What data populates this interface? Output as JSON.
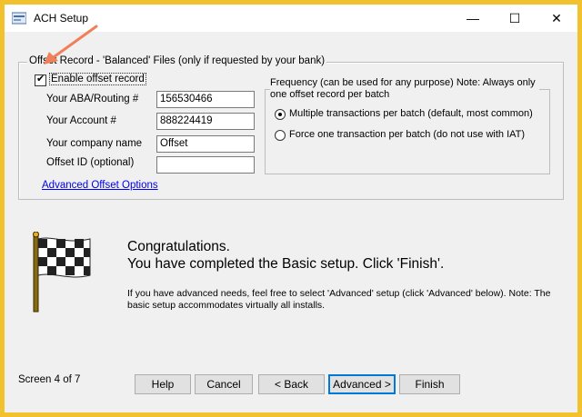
{
  "window": {
    "title": "ACH Setup",
    "controls": {
      "minimize": "—",
      "maximize": "☐",
      "close": "✕"
    }
  },
  "offset_group": {
    "legend": "Offset Record - 'Balanced' Files (only if requested by your bank)",
    "enable_label": "Enable offset record",
    "enable_checked": true,
    "fields": [
      {
        "label": "Your ABA/Routing #",
        "value": "156530466"
      },
      {
        "label": "Your Account #",
        "value": "888224419"
      },
      {
        "label": "Your company name",
        "value": "Offset"
      },
      {
        "label": "Offset ID (optional)",
        "value": ""
      }
    ],
    "frequency": {
      "legend": "Frequency (can be used for any purpose) Note: Always only one offset record per batch",
      "options": [
        {
          "label": "Multiple transactions per batch (default, most common)",
          "selected": true
        },
        {
          "label": "Force one transaction per batch (do not use with IAT)",
          "selected": false
        }
      ]
    },
    "advanced_link": "Advanced Offset Options"
  },
  "completion": {
    "line1": "Congratulations.",
    "line2": "You have completed the Basic setup. Click 'Finish'.",
    "note": "If you have advanced needs, feel free to select 'Advanced' setup (click 'Advanced' below). Note: The basic setup accommodates virtually all installs."
  },
  "footer": {
    "screen_indicator": "Screen 4 of 7",
    "buttons": {
      "help": "Help",
      "cancel": "Cancel",
      "back": "< Back",
      "advanced": "Advanced >",
      "finish": "Finish"
    }
  },
  "colors": {
    "frame": "#f2c12e",
    "window_bg": "#f0f0f0",
    "link": "#0000ee",
    "annotation_arrow": "#f0805a"
  },
  "icons": {
    "app": "app-icon",
    "flag": "checkered-flag-icon",
    "arrow": "annotation-arrow-icon"
  }
}
